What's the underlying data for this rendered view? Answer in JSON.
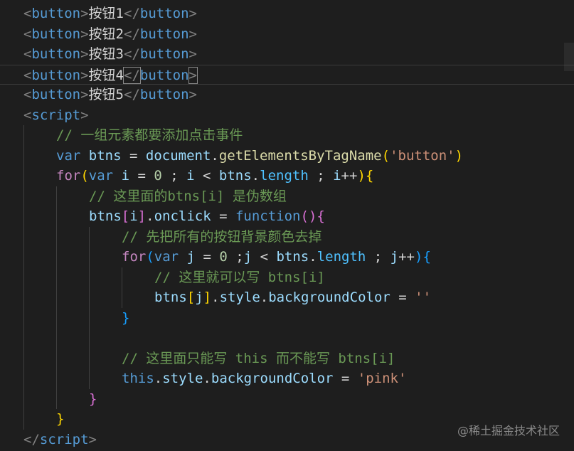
{
  "editor": {
    "lines": [
      {
        "indent": 0,
        "tokens": [
          [
            "punct",
            "<"
          ],
          [
            "tag",
            "button"
          ],
          [
            "punct",
            ">"
          ],
          [
            "text",
            "按钮1"
          ],
          [
            "punct",
            "</"
          ],
          [
            "tag",
            "button"
          ],
          [
            "punct",
            ">"
          ]
        ]
      },
      {
        "indent": 0,
        "tokens": [
          [
            "punct",
            "<"
          ],
          [
            "tag",
            "button"
          ],
          [
            "punct",
            ">"
          ],
          [
            "text",
            "按钮2"
          ],
          [
            "punct",
            "</"
          ],
          [
            "tag",
            "button"
          ],
          [
            "punct",
            ">"
          ]
        ]
      },
      {
        "indent": 0,
        "tokens": [
          [
            "punct",
            "<"
          ],
          [
            "tag",
            "button"
          ],
          [
            "punct",
            ">"
          ],
          [
            "text",
            "按钮3"
          ],
          [
            "punct",
            "</"
          ],
          [
            "tag",
            "button"
          ],
          [
            "punct",
            ">"
          ]
        ]
      },
      {
        "indent": 0,
        "current": true,
        "tokens": [
          [
            "punct",
            "<"
          ],
          [
            "tag",
            "button"
          ],
          [
            "punct",
            ">"
          ],
          [
            "text",
            "按钮4"
          ],
          [
            "punct",
            "</"
          ],
          [
            "tag",
            "button"
          ],
          [
            "punct",
            ">"
          ]
        ]
      },
      {
        "indent": 0,
        "tokens": [
          [
            "punct",
            "<"
          ],
          [
            "tag",
            "button"
          ],
          [
            "punct",
            ">"
          ],
          [
            "text",
            "按钮5"
          ],
          [
            "punct",
            "</"
          ],
          [
            "tag",
            "button"
          ],
          [
            "punct",
            ">"
          ]
        ]
      },
      {
        "indent": 0,
        "tokens": [
          [
            "punct",
            "<"
          ],
          [
            "tag",
            "script"
          ],
          [
            "punct",
            ">"
          ]
        ]
      },
      {
        "indent": 1,
        "tokens": [
          [
            "comment",
            "// 一组元素都要添加点击事件"
          ]
        ]
      },
      {
        "indent": 1,
        "tokens": [
          [
            "keyword",
            "var"
          ],
          [
            "op",
            " "
          ],
          [
            "var",
            "btns"
          ],
          [
            "op",
            " = "
          ],
          [
            "var",
            "document"
          ],
          [
            "op",
            "."
          ],
          [
            "func",
            "getElementsByTagName"
          ],
          [
            "brace1",
            "("
          ],
          [
            "string",
            "'button'"
          ],
          [
            "brace1",
            ")"
          ]
        ]
      },
      {
        "indent": 1,
        "tokens": [
          [
            "control",
            "for"
          ],
          [
            "brace1",
            "("
          ],
          [
            "keyword",
            "var"
          ],
          [
            "op",
            " "
          ],
          [
            "var",
            "i"
          ],
          [
            "op",
            " = "
          ],
          [
            "number",
            "0"
          ],
          [
            "op",
            " ; "
          ],
          [
            "var",
            "i"
          ],
          [
            "op",
            " < "
          ],
          [
            "var",
            "btns"
          ],
          [
            "op",
            "."
          ],
          [
            "prop",
            "length"
          ],
          [
            "op",
            " ; "
          ],
          [
            "var",
            "i"
          ],
          [
            "op",
            "++"
          ],
          [
            "brace1",
            ")"
          ],
          [
            "brace1",
            "{"
          ]
        ]
      },
      {
        "indent": 2,
        "tokens": [
          [
            "comment",
            "// 这里面的btns[i] 是伪数组"
          ]
        ]
      },
      {
        "indent": 2,
        "tokens": [
          [
            "var",
            "btns"
          ],
          [
            "brace2",
            "["
          ],
          [
            "var",
            "i"
          ],
          [
            "brace2",
            "]"
          ],
          [
            "op",
            "."
          ],
          [
            "var",
            "onclick"
          ],
          [
            "op",
            " = "
          ],
          [
            "keyword",
            "function"
          ],
          [
            "brace2",
            "()"
          ],
          [
            "brace2",
            "{"
          ]
        ]
      },
      {
        "indent": 3,
        "tokens": [
          [
            "comment",
            "// 先把所有的按钮背景颜色去掉"
          ]
        ]
      },
      {
        "indent": 3,
        "tokens": [
          [
            "control",
            "for"
          ],
          [
            "brace3",
            "("
          ],
          [
            "keyword",
            "var"
          ],
          [
            "op",
            " "
          ],
          [
            "var",
            "j"
          ],
          [
            "op",
            " = "
          ],
          [
            "number",
            "0"
          ],
          [
            "op",
            " ;"
          ],
          [
            "var",
            "j"
          ],
          [
            "op",
            " < "
          ],
          [
            "var",
            "btns"
          ],
          [
            "op",
            "."
          ],
          [
            "prop",
            "length"
          ],
          [
            "op",
            " ; "
          ],
          [
            "var",
            "j"
          ],
          [
            "op",
            "++"
          ],
          [
            "brace3",
            ")"
          ],
          [
            "brace3",
            "{"
          ]
        ]
      },
      {
        "indent": 4,
        "tokens": [
          [
            "comment",
            "// 这里就可以写 btns[i]"
          ]
        ]
      },
      {
        "indent": 4,
        "tokens": [
          [
            "var",
            "btns"
          ],
          [
            "brace1",
            "["
          ],
          [
            "var",
            "j"
          ],
          [
            "brace1",
            "]"
          ],
          [
            "op",
            "."
          ],
          [
            "var",
            "style"
          ],
          [
            "op",
            "."
          ],
          [
            "var",
            "backgroundColor"
          ],
          [
            "op",
            " = "
          ],
          [
            "string",
            "''"
          ]
        ]
      },
      {
        "indent": 3,
        "tokens": [
          [
            "brace3",
            "}"
          ]
        ]
      },
      {
        "indent": 3,
        "tokens": []
      },
      {
        "indent": 3,
        "tokens": [
          [
            "comment",
            "// 这里面只能写 this 而不能写 btns[i]"
          ]
        ]
      },
      {
        "indent": 3,
        "tokens": [
          [
            "keyword",
            "this"
          ],
          [
            "op",
            "."
          ],
          [
            "var",
            "style"
          ],
          [
            "op",
            "."
          ],
          [
            "var",
            "backgroundColor"
          ],
          [
            "op",
            " = "
          ],
          [
            "string",
            "'pink'"
          ]
        ]
      },
      {
        "indent": 2,
        "tokens": [
          [
            "brace2",
            "}"
          ]
        ]
      },
      {
        "indent": 1,
        "tokens": [
          [
            "brace1",
            "}"
          ]
        ]
      },
      {
        "indent": 0,
        "tokens": [
          [
            "punct",
            "</"
          ],
          [
            "tag",
            "script"
          ],
          [
            "punct",
            ">"
          ]
        ]
      }
    ]
  },
  "watermark": "@稀土掘金技术社区"
}
